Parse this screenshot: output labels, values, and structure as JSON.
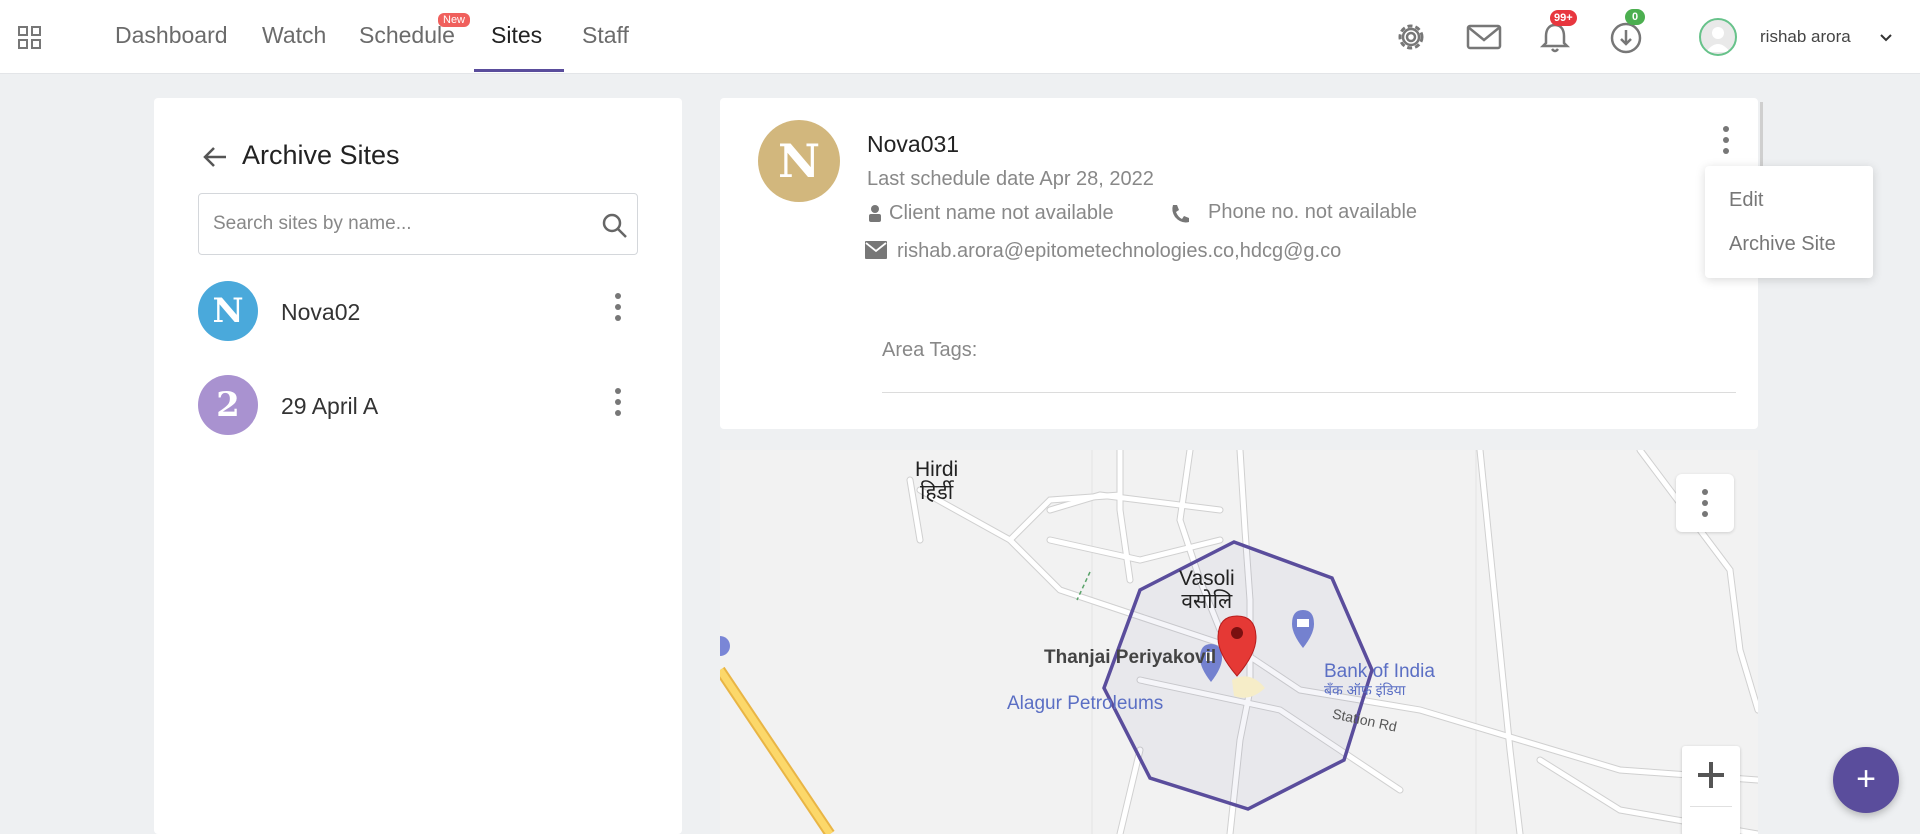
{
  "nav": {
    "items": [
      "Dashboard",
      "Watch",
      "Schedule",
      "Sites",
      "Staff"
    ],
    "new_badge": "New",
    "active": "Sites"
  },
  "top_icons": {
    "settings": "gear-icon",
    "mail": "mail-icon",
    "notifications": "bell-icon",
    "notifications_count": "99+",
    "downloads": "download-clock-icon",
    "downloads_count": "0"
  },
  "user": {
    "name": "rishab arora"
  },
  "left_panel": {
    "title": "Archive Sites",
    "search_placeholder": "Search sites by name...",
    "sites": [
      {
        "initial": "N",
        "name": "Nova02",
        "color": "#4aa9db"
      },
      {
        "initial": "2",
        "name": "29 April A",
        "color": "#a992d0"
      }
    ]
  },
  "detail": {
    "initial": "N",
    "name": "Nova031",
    "last_schedule": "Last schedule date Apr 28, 2022",
    "client": "Client name not available",
    "phone": "Phone no. not available",
    "email": "rishab.arora@epitometechnologies.co,hdcg@g.co",
    "area_tags_label": "Area Tags:"
  },
  "dropdown": {
    "items": [
      "Edit",
      "Archive Site"
    ]
  },
  "map": {
    "labels": {
      "hirdi_en": "Hirdi",
      "hirdi_hi": "हिर्डी",
      "vasoli_en": "Vasoli",
      "vasoli_hi": "वसोलि",
      "temple": "Thanjai Periyakovil",
      "petrol": "Alagur Petroleums",
      "bank_en": "Bank of India",
      "bank_hi": "बँक ऑफ इंडिया",
      "road": "Station Rd"
    }
  },
  "fab_label": "+",
  "colors": {
    "accent": "#5a4d9c",
    "badge_red": "#e8373f",
    "badge_green": "#4caf50"
  }
}
